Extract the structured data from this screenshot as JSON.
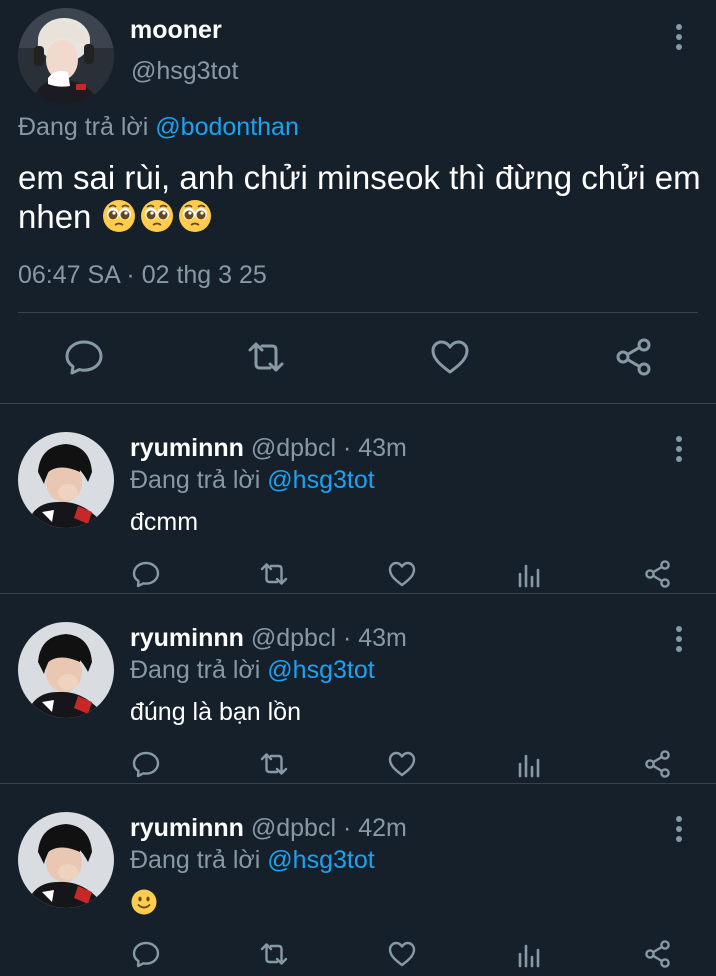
{
  "main_tweet": {
    "display_name": "mooner",
    "handle": "@hsg3tot",
    "replying_prefix": "Đang trả lời",
    "replying_to": "@bodonthan",
    "text": "em sai rùi, anh chửi minseok thì đừng chửi em nhen",
    "emoji": "pleading-face",
    "emoji_count": 3,
    "timestamp": "06:47 SA · 02 thg 3 25",
    "actions": [
      "reply-icon",
      "retweet-icon",
      "like-icon",
      "share-icon"
    ]
  },
  "replies": [
    {
      "display_name": "ryuminnn",
      "meta": "@dpbcl · 43m",
      "replying_prefix": "Đang trả lời",
      "replying_to": "@hsg3tot",
      "text": "đcmm"
    },
    {
      "display_name": "ryuminnn",
      "meta": "@dpbcl · 43m",
      "replying_prefix": "Đang trả lời",
      "replying_to": "@hsg3tot",
      "text": "đúng là bạn lồn"
    },
    {
      "display_name": "ryuminnn",
      "meta": "@dpbcl · 42m",
      "replying_prefix": "Đang trả lời",
      "replying_to": "@hsg3tot",
      "text": "",
      "emoji": "slightly-smiling-face"
    }
  ],
  "reply_actions": [
    "reply-icon",
    "retweet-icon",
    "like-icon",
    "analytics-icon",
    "share-icon"
  ],
  "colors": {
    "background": "#15202b",
    "secondary_text": "#8899a6",
    "mention": "#1da1f2",
    "divider": "#38444d"
  }
}
